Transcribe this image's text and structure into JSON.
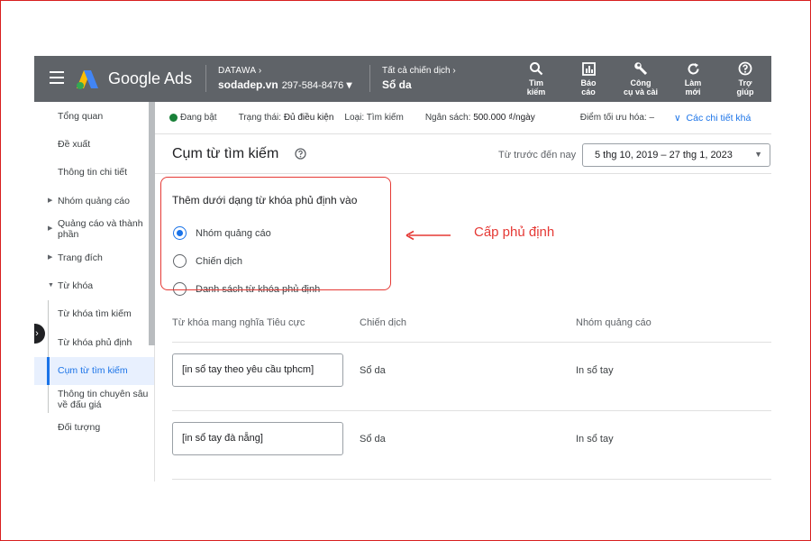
{
  "topbar": {
    "brand": "Google Ads",
    "account_label": "DATAWA",
    "account_chevron": "›",
    "account_name": "sodadep.vn",
    "account_id": "297-584-8476",
    "account_dropdown": "▾",
    "campaign_label": "Tất cả chiến dịch",
    "campaign_chevron": "›",
    "campaign_name": "Sổ da",
    "tools": [
      {
        "icon": "search-icon",
        "label1": "Tìm",
        "label2": "kiếm"
      },
      {
        "icon": "report-icon",
        "label1": "Báo",
        "label2": "cáo"
      },
      {
        "icon": "wrench-icon",
        "label1": "Công",
        "label2": "cụ và cài"
      },
      {
        "icon": "refresh-icon",
        "label1": "Làm",
        "label2": "mới"
      },
      {
        "icon": "help-icon",
        "label1": "Trợ",
        "label2": "giúp"
      }
    ]
  },
  "sidebar": {
    "items": [
      {
        "label": "Tổng quan"
      },
      {
        "label": "Đề xuất"
      },
      {
        "label": "Thông tin chi tiết"
      },
      {
        "label": "Nhóm quảng cáo",
        "caret": "▶"
      },
      {
        "label": "Quảng cáo và thành phần",
        "caret": "▶"
      },
      {
        "label": "Trang đích",
        "caret": "▶"
      },
      {
        "label": "Từ khóa",
        "caret": "▼"
      },
      {
        "label": "Từ khóa tìm kiếm"
      },
      {
        "label": "Từ khóa phủ định"
      },
      {
        "label": "Cụm từ tìm kiếm"
      },
      {
        "label": "Thông tin chuyên sâu về đấu giá"
      },
      {
        "label": "Đối tượng"
      }
    ],
    "collapse_glyph": "›"
  },
  "statusbar": {
    "state": "Đang bật",
    "status_label": "Trạng thái:",
    "status_value": "Đủ điều kiện",
    "type_label": "Loại:",
    "type_value": "Tìm kiếm",
    "budget_label": "Ngân sách:",
    "budget_value": "500.000 ₫/ngày",
    "opt_label": "Điểm tối ưu hóa:",
    "opt_value": "–",
    "details_chevron": "∨",
    "details_link": "Các chi tiết khá"
  },
  "header": {
    "title": "Cụm từ tìm kiếm",
    "range_label": "Từ trước đến nay",
    "range_value": "5 thg 10, 2019 – 27 thg 1, 2023",
    "range_arrow": "▼"
  },
  "negative": {
    "title": "Thêm dưới dạng từ khóa phủ định vào",
    "options": [
      {
        "label": "Nhóm quảng cáo",
        "selected": true
      },
      {
        "label": "Chiến dịch",
        "selected": false
      },
      {
        "label": "Danh sách từ khóa phủ định",
        "selected": false
      }
    ]
  },
  "table": {
    "columns": [
      "Từ khóa mang nghĩa Tiêu cực",
      "Chiến dịch",
      "Nhóm quảng cáo"
    ],
    "rows": [
      {
        "keyword": "[in sổ tay theo yêu cầu tphcm]",
        "campaign": "Sổ da",
        "adgroup": "In sổ tay"
      },
      {
        "keyword": "[in sổ tay đà nẵng]",
        "campaign": "Sổ da",
        "adgroup": "In sổ tay"
      }
    ]
  },
  "annotation": {
    "label": "Cấp phủ định",
    "color": "#e53935"
  },
  "colors": {
    "topbar": "#5f6368",
    "accent": "#1a73e8",
    "enabled_dot": "#188038"
  }
}
